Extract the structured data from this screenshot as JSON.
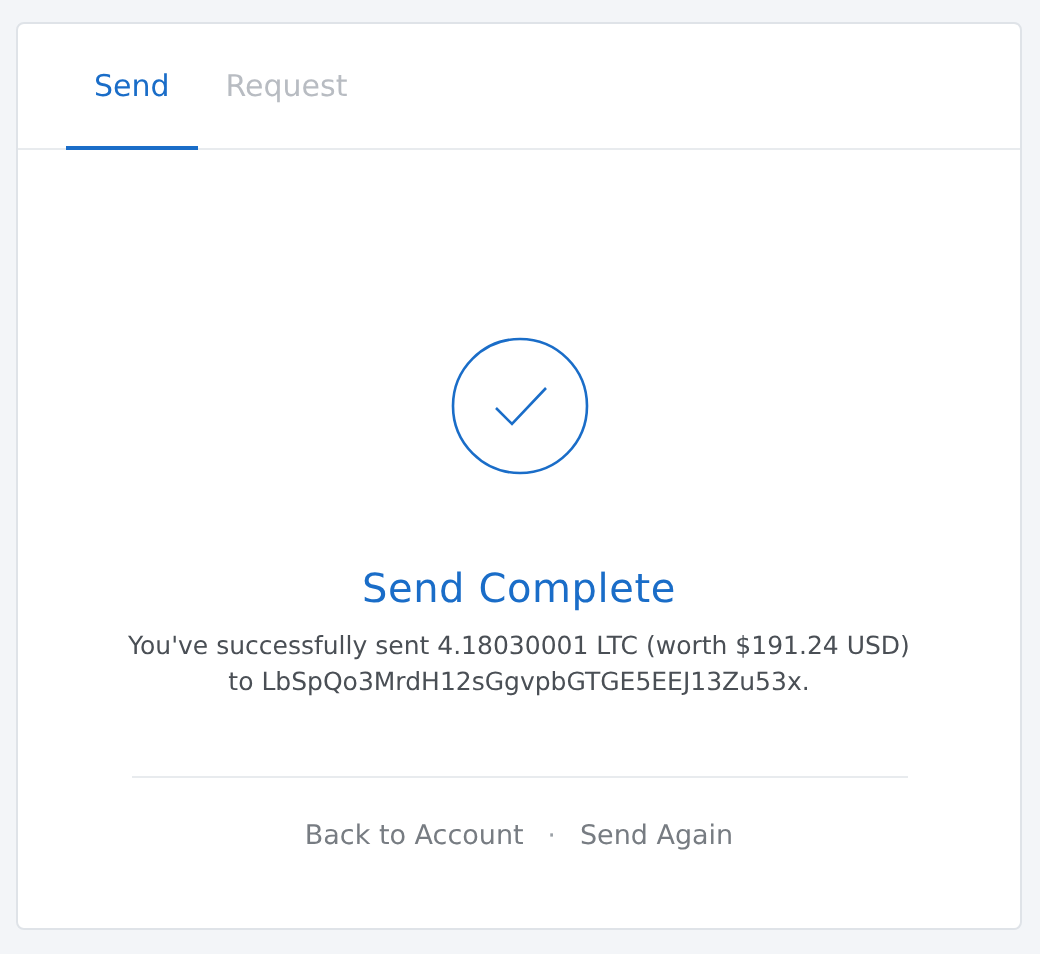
{
  "tabs": [
    {
      "label": "Send",
      "selected": true
    },
    {
      "label": "Request",
      "selected": false
    }
  ],
  "result": {
    "title": "Send Complete",
    "message": "You've successfully sent 4.18030001 LTC (worth $191.24 USD) to LbSpQo3MrdH12sGgvpbGTGE5EEJ13Zu53x."
  },
  "links": [
    {
      "label": "Back to Account"
    },
    {
      "label": "Send Again"
    }
  ],
  "separator": "·"
}
